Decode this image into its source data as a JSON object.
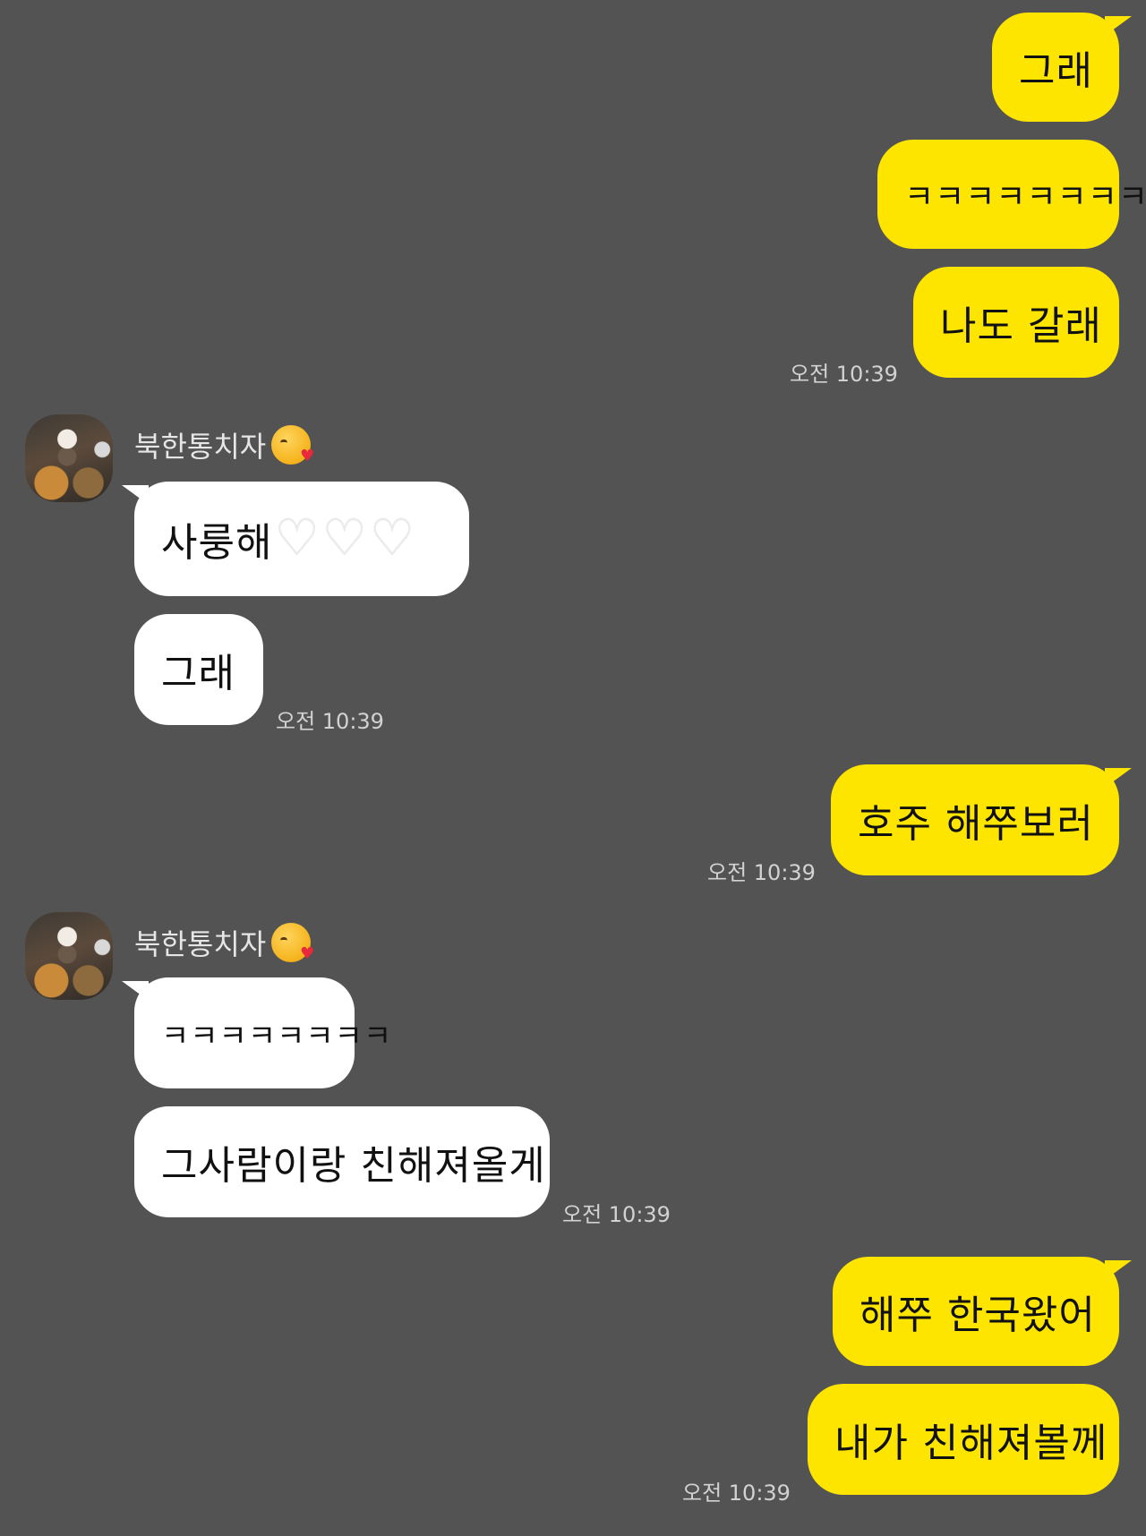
{
  "contact": {
    "name": "북한통치자",
    "name_emoji": "kissing-face-with-heart"
  },
  "messages": {
    "m1": "그래",
    "m2": "ㅋㅋㅋㅋㅋㅋㅋㅋㅋ",
    "m3": "나도 갈래",
    "m4": "사룽해",
    "m5": "그래",
    "m6": "호주 해쭈보러",
    "m7": "ㅋㅋㅋㅋㅋㅋㅋㅋ",
    "m8": "그사람이랑 친해져올게",
    "m9": "해쭈 한국왔어",
    "m10": "내가 친해져볼께"
  },
  "times": {
    "t1": "오전 10:39",
    "t2": "오전 10:39",
    "t3": "오전 10:39",
    "t4": "오전 10:39",
    "t5": "오전 10:39"
  },
  "colors": {
    "background": "#545353",
    "my_bubble": "#FEE500",
    "their_bubble": "#FFFFFF"
  }
}
